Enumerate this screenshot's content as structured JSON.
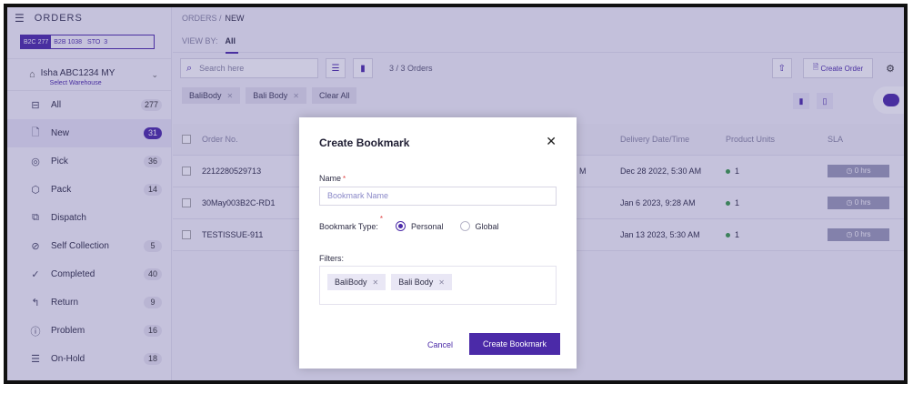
{
  "sidebar": {
    "title": "ORDERS",
    "channels": [
      {
        "label": "B2C",
        "count": "277"
      },
      {
        "label": "B2B",
        "count": "1038"
      },
      {
        "label": "STO",
        "count": "3"
      }
    ],
    "warehouse": {
      "name": "Isha ABC1234 MY",
      "action": "Select Warehouse"
    },
    "items": [
      {
        "label": "All",
        "count": "277"
      },
      {
        "label": "New",
        "count": "31"
      },
      {
        "label": "Pick",
        "count": "36"
      },
      {
        "label": "Pack",
        "count": "14"
      },
      {
        "label": "Dispatch",
        "count": ""
      },
      {
        "label": "Self Collection",
        "count": "5"
      },
      {
        "label": "Completed",
        "count": "40"
      },
      {
        "label": "Return",
        "count": "9"
      },
      {
        "label": "Problem",
        "count": "16"
      },
      {
        "label": "On-Hold",
        "count": "18"
      }
    ]
  },
  "header": {
    "breadcrumb_root": "ORDERS /",
    "breadcrumb_current": "NEW",
    "view_by_label": "VIEW BY:",
    "view_by_value": "All"
  },
  "toolbar": {
    "search_placeholder": "Search here",
    "result_count": "3 / 3 Orders",
    "create_order": "Create Order"
  },
  "filters": {
    "chips": [
      "BaliBody",
      "Bali Body"
    ],
    "clear": "Clear All"
  },
  "table": {
    "headers": {
      "order_no": "Order No.",
      "delivery": "Delivery Date/Time",
      "units": "Product Units",
      "sla": "SLA"
    },
    "rows": [
      {
        "order_no": "2212280529713",
        "partial": "M",
        "delivery": "Dec 28 2022, 5:30 AM",
        "units": "1",
        "sla": "0 hrs"
      },
      {
        "order_no": "30May003B2C-RD1",
        "partial": "",
        "delivery": "Jan 6 2023, 9:28 AM",
        "units": "1",
        "sla": "0 hrs"
      },
      {
        "order_no": "TESTISSUE-911",
        "partial": "",
        "delivery": "Jan 13 2023, 5:30 AM",
        "units": "1",
        "sla": "0 hrs"
      }
    ]
  },
  "modal": {
    "title": "Create Bookmark",
    "name_label": "Name",
    "name_placeholder": "Bookmark Name",
    "type_label": "Bookmark Type:",
    "type_options": [
      "Personal",
      "Global"
    ],
    "filters_label": "Filters:",
    "filter_chips": [
      "BaliBody",
      "Bali Body"
    ],
    "cancel": "Cancel",
    "submit": "Create Bookmark"
  },
  "colors": {
    "accent": "#4b2aa8",
    "overlay": "#463c8c"
  }
}
